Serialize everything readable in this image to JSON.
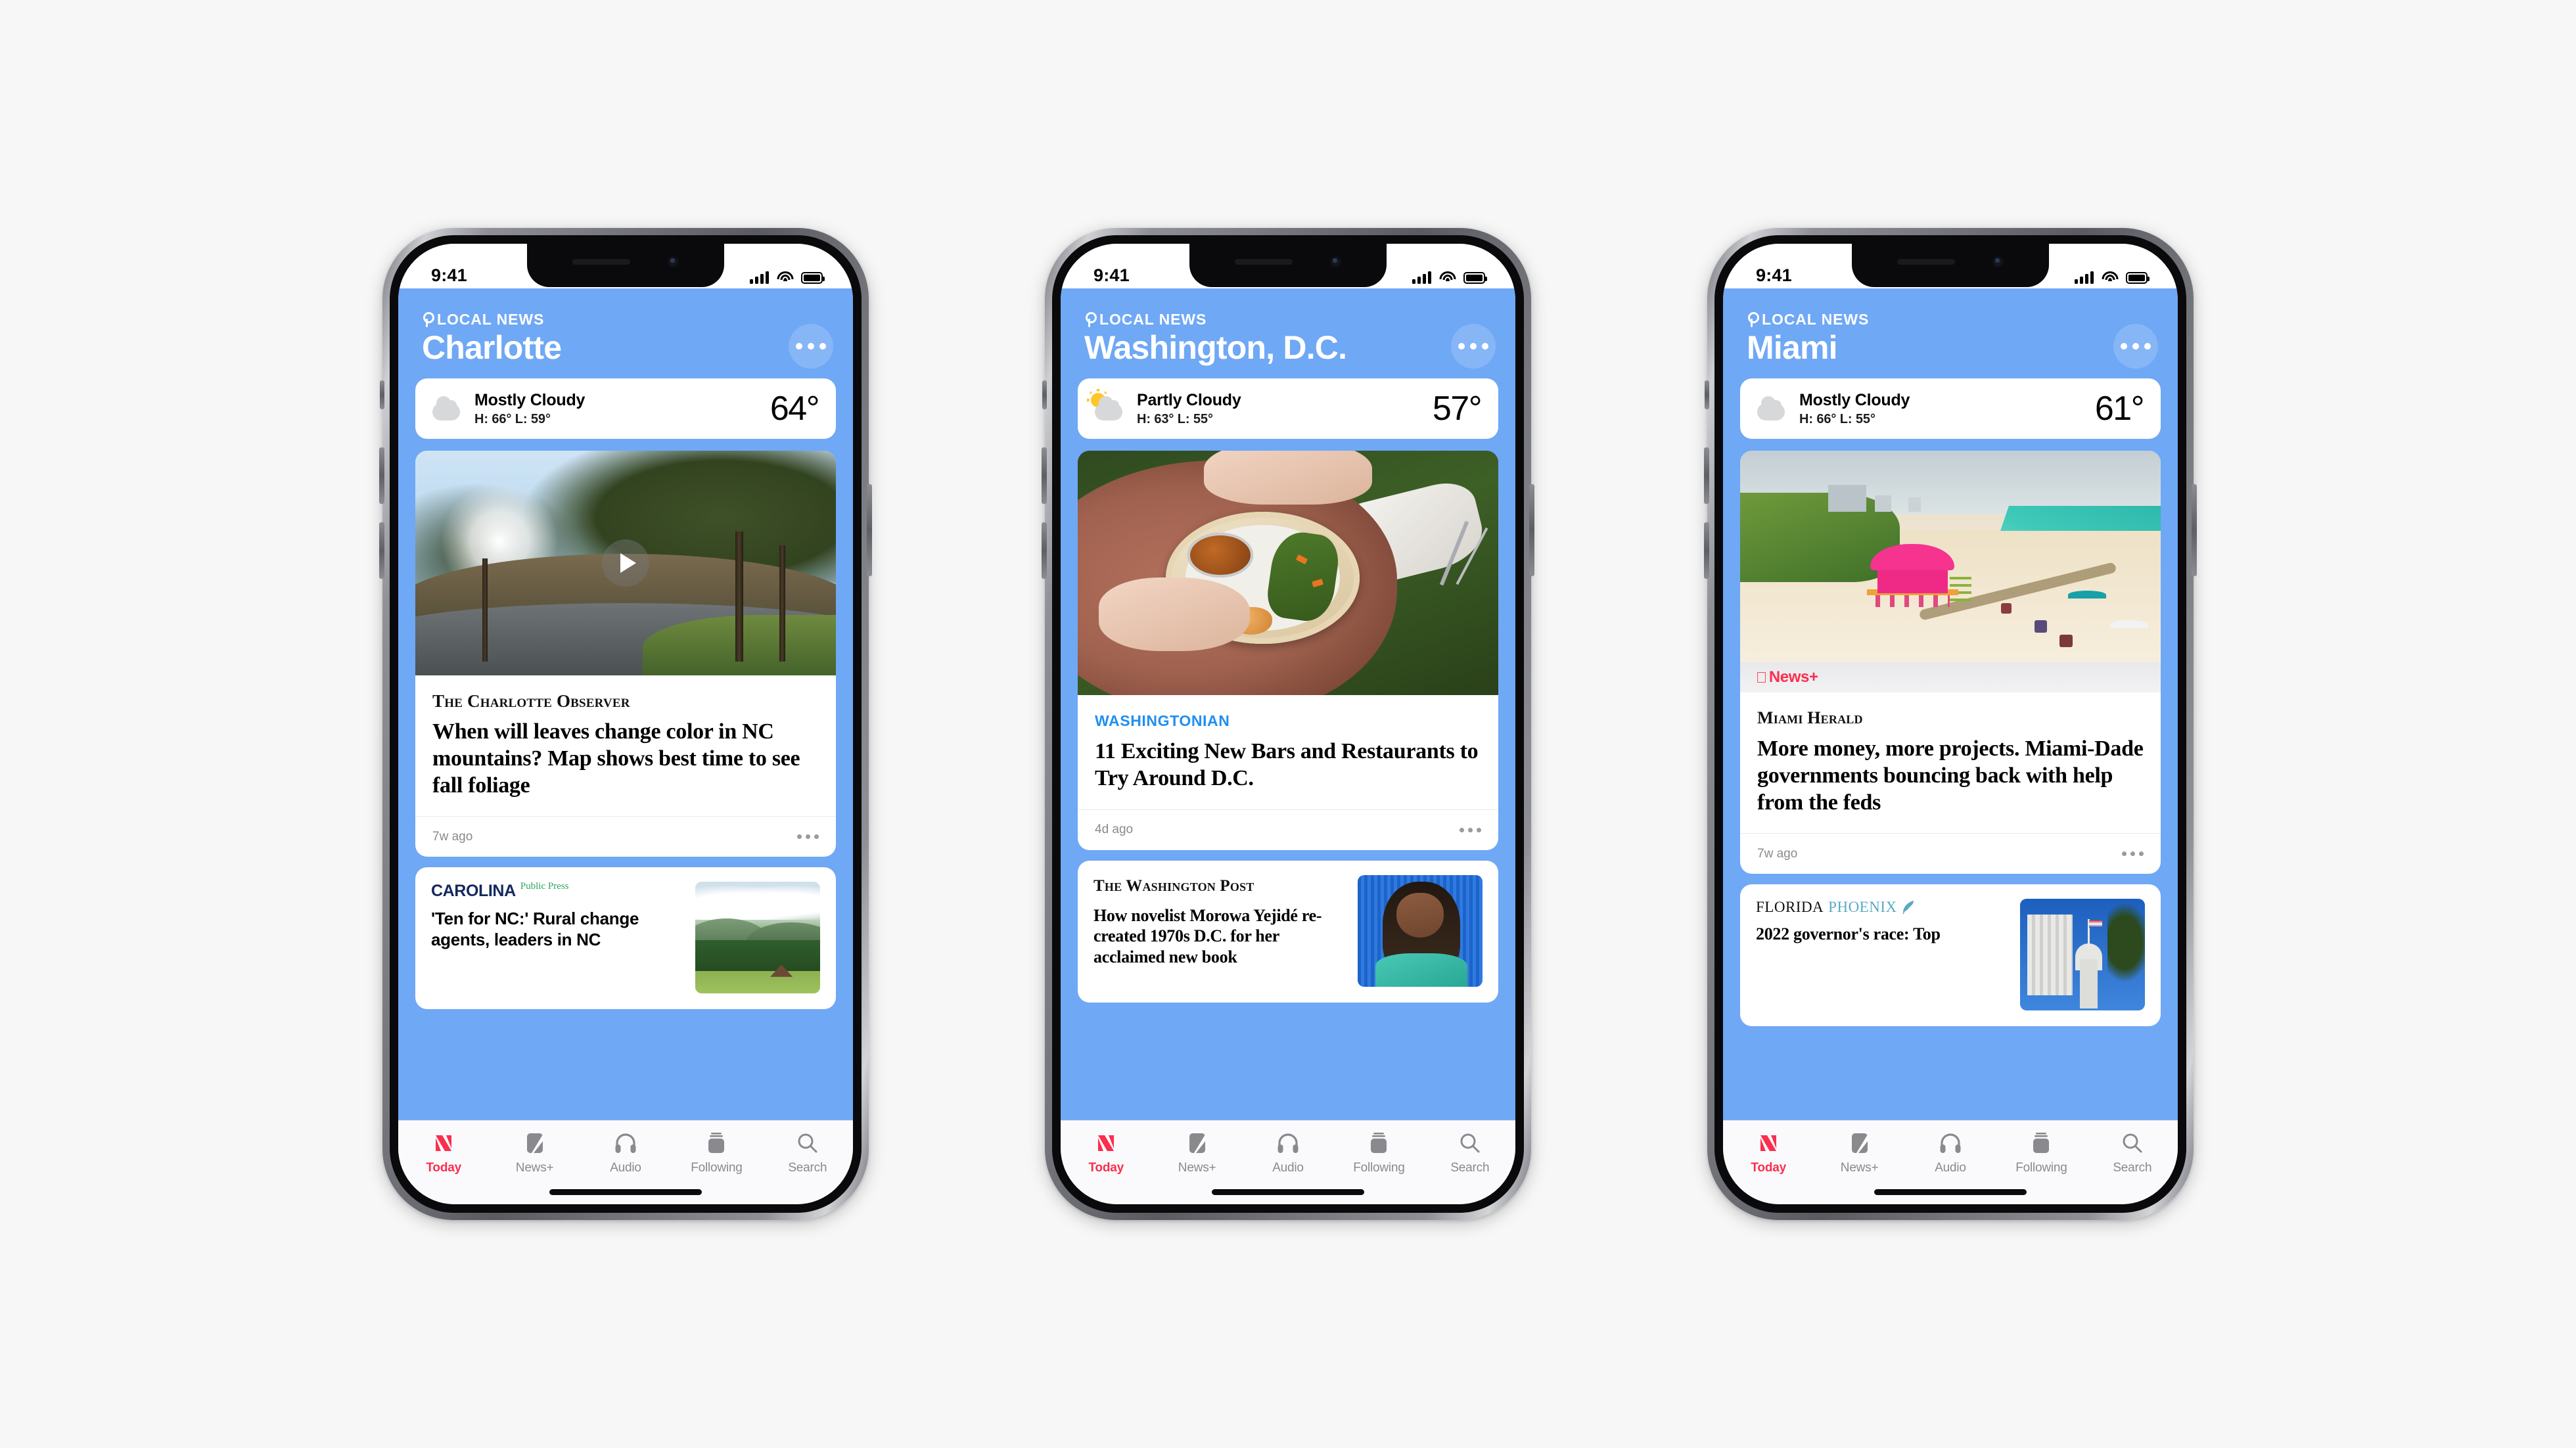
{
  "phones": [
    {
      "status": {
        "time": "9:41"
      },
      "header": {
        "kicker": "LOCAL NEWS",
        "city": "Charlotte"
      },
      "weather": {
        "condition": "Mostly Cloudy",
        "high_low": "H: 66°  L: 59°",
        "temp": "64°",
        "icon": "cloud-icon"
      },
      "cards": [
        {
          "type": "hero-video",
          "publisher": "The Charlotte Observer",
          "publisher_style": "observer",
          "headline": "When will leaves change color in NC mountains? Map shows best time to see fall foliage",
          "ago": "7w ago",
          "image": "nc-mountain-road",
          "has_play": true
        },
        {
          "type": "split",
          "publisher_a": "CAROLINA",
          "publisher_b": "Public Press",
          "publisher_style": "carolina-public-press",
          "headline": "'Ten for NC:' Rural change agents, leaders in NC",
          "image": "nc-green-hills"
        }
      ],
      "tabs": [
        {
          "label": "Today",
          "icon": "apple-news-icon",
          "active": true
        },
        {
          "label": "News+",
          "icon": "newsplus-icon",
          "active": false
        },
        {
          "label": "Audio",
          "icon": "headphones-icon",
          "active": false
        },
        {
          "label": "Following",
          "icon": "following-icon",
          "active": false
        },
        {
          "label": "Search",
          "icon": "search-icon",
          "active": false
        }
      ]
    },
    {
      "status": {
        "time": "9:41"
      },
      "header": {
        "kicker": "LOCAL NEWS",
        "city": "Washington, D.C."
      },
      "weather": {
        "condition": "Partly Cloudy",
        "high_low": "H: 63°  L: 55°",
        "temp": "57°",
        "icon": "sun-cloud-icon"
      },
      "cards": [
        {
          "type": "hero",
          "publisher": "WASHINGTONIAN",
          "publisher_style": "washingtonian",
          "headline": "11 Exciting New Bars and Restaurants to Try Around D.C.",
          "ago": "4d ago",
          "image": "picnic-food-bowl",
          "has_play": false
        },
        {
          "type": "split",
          "publisher": "The Washington Post",
          "publisher_style": "wapo",
          "headline": "How novelist Morowa Yejidé re-created 1970s D.C. for her acclaimed new book",
          "image": "woman-portrait"
        }
      ],
      "tabs": [
        {
          "label": "Today",
          "icon": "apple-news-icon",
          "active": true
        },
        {
          "label": "News+",
          "icon": "newsplus-icon",
          "active": false
        },
        {
          "label": "Audio",
          "icon": "headphones-icon",
          "active": false
        },
        {
          "label": "Following",
          "icon": "following-icon",
          "active": false
        },
        {
          "label": "Search",
          "icon": "search-icon",
          "active": false
        }
      ]
    },
    {
      "status": {
        "time": "9:41"
      },
      "header": {
        "kicker": "LOCAL NEWS",
        "city": "Miami"
      },
      "weather": {
        "condition": "Mostly Cloudy",
        "high_low": "H: 66°  L: 55°",
        "temp": "61°",
        "icon": "cloud-icon"
      },
      "cards": [
        {
          "type": "hero",
          "badge": "News+",
          "publisher": "Miami Herald",
          "publisher_style": "herald",
          "headline": "More money, more projects. Miami-Dade governments bouncing back with help from the feds",
          "ago": "7w ago",
          "image": "miami-beach-lifeguard-tower",
          "has_play": false
        },
        {
          "type": "split",
          "publisher_a": "FLORIDA",
          "publisher_b": "PHOENIX",
          "publisher_style": "florida-phoenix",
          "headline": "2022 governor's race: Top",
          "image": "florida-capitol"
        }
      ],
      "tabs": [
        {
          "label": "Today",
          "icon": "apple-news-icon",
          "active": true
        },
        {
          "label": "News+",
          "icon": "newsplus-icon",
          "active": false
        },
        {
          "label": "Audio",
          "icon": "headphones-icon",
          "active": false
        },
        {
          "label": "Following",
          "icon": "following-icon",
          "active": false
        },
        {
          "label": "Search",
          "icon": "search-icon",
          "active": false
        }
      ]
    }
  ],
  "colors": {
    "app_blue": "#6FA8F5",
    "accent_red": "#FB2E4E",
    "page_background": "#F7F7F7"
  }
}
